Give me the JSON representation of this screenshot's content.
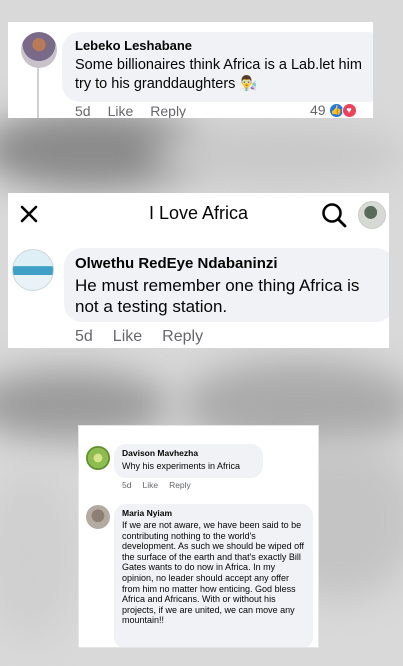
{
  "comment1": {
    "author": "Lebeko Leshabane",
    "text": "Some billionaires think Africa is a Lab.let him try to his granddaughters 👨‍🔬",
    "time": "5d",
    "like_label": "Like",
    "reply_label": "Reply",
    "reaction_count": "49",
    "reactions": [
      "like",
      "love"
    ]
  },
  "page_header": {
    "close_icon": "close-icon",
    "title": "I Love Africa",
    "search_icon": "search-icon"
  },
  "comment2": {
    "author": "Olwethu RedEye Ndabaninzi",
    "text": "He must remember one thing Africa is not a testing station.",
    "time": "5d",
    "like_label": "Like",
    "reply_label": "Reply"
  },
  "comment3": {
    "author": "Davison Mavhezha",
    "text": "Why his experiments in Africa",
    "time": "5d",
    "like_label": "Like",
    "reply_label": "Reply"
  },
  "comment4": {
    "author": "Maria Nyiam",
    "text": "If we are not aware, we have been said to be contributing nothing to the world's development. As such we should be wiped off the surface of the earth and that's exactly Bill Gates wants to do now in Africa. In my opinion, no leader should accept any offer from him no matter how enticing. God bless Africa and Africans. With or without his projects, if we are united, we can move any mountain!!"
  },
  "colors": {
    "bubble": "#f0f2f5",
    "text": "#050505",
    "secondary_text": "#65676b",
    "like_blue": "#1877f2",
    "love_red": "#f33e58"
  }
}
